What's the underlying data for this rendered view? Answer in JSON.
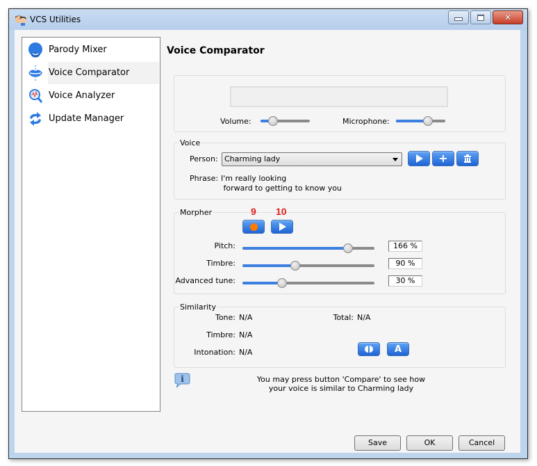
{
  "window": {
    "title": "VCS Utilities",
    "controls": {
      "minimize": "minimize",
      "maximize": "maximize",
      "close": "close"
    }
  },
  "sidebar": {
    "items": [
      {
        "label": "Parody Mixer",
        "icon": "face-icon",
        "selected": false
      },
      {
        "label": "Voice Comparator",
        "icon": "lips-icon",
        "selected": true
      },
      {
        "label": "Voice Analyzer",
        "icon": "magnifier-wave-icon",
        "selected": false
      },
      {
        "label": "Update Manager",
        "icon": "refresh-arrows-icon",
        "selected": false
      }
    ]
  },
  "main": {
    "title": "Voice Comparator",
    "levels": {
      "volume_label": "Volume:",
      "volume_value": 0.25,
      "microphone_label": "Microphone:",
      "microphone_value": 0.65
    },
    "voice": {
      "group_label": "Voice",
      "person_label": "Person:",
      "person_value": "Charming lady",
      "phrase_label": "Phrase:",
      "phrase_line1": "I'm really looking",
      "phrase_line2": " forward to getting to know you",
      "buttons": [
        "play",
        "add",
        "delete"
      ]
    },
    "morpher": {
      "group_label": "Morpher",
      "annotation_record": "9",
      "annotation_play": "10",
      "pitch_label": "Pitch:",
      "pitch_value": "166 %",
      "pitch_fraction": 0.8,
      "timbre_label": "Timbre:",
      "timbre_value": "90 %",
      "timbre_fraction": 0.4,
      "tune_label": "Advanced tune:",
      "tune_value": "30 %",
      "tune_fraction": 0.3
    },
    "similarity": {
      "group_label": "Similarity",
      "tone_label": "Tone:",
      "tone_value": "N/A",
      "total_label": "Total:",
      "total_value": "N/A",
      "timbre_label": "Timbre:",
      "timbre_value": "N/A",
      "intonation_label": "Intonation:",
      "intonation_value": "N/A",
      "compare_button_glyph": "◐",
      "a_button_label": "A"
    },
    "info": {
      "line1": "You may press button 'Compare' to see how",
      "line2": "your voice is similar to Charming lady"
    }
  },
  "footer": {
    "save_label": "Save",
    "ok_label": "OK",
    "cancel_label": "Cancel"
  },
  "colors": {
    "accent_blue": "#2f72e0",
    "annotation_red": "#e02020",
    "record_orange": "#ff7a00"
  }
}
